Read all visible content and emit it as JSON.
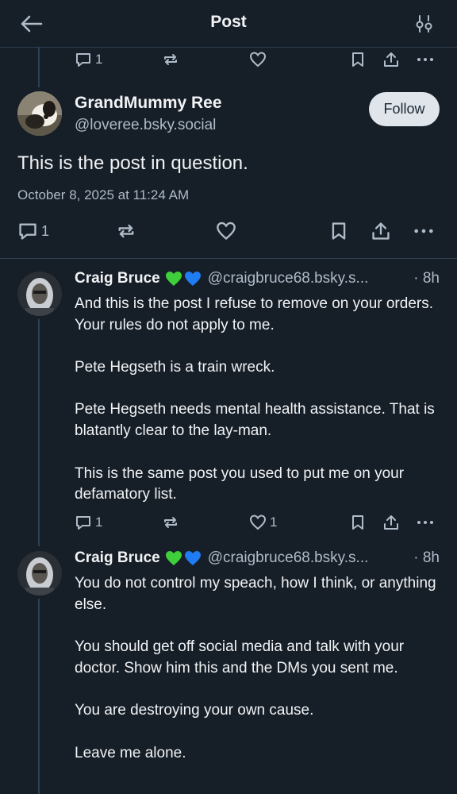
{
  "header": {
    "title": "Post"
  },
  "parent_actions": {
    "reply_count": "1"
  },
  "main_post": {
    "author_name": "GrandMummy Ree",
    "author_handle": "@loveree.bsky.social",
    "follow_label": "Follow",
    "text": "This is the post in question.",
    "timestamp": "October 8, 2025 at 11:24 AM",
    "reply_count": "1"
  },
  "replies": [
    {
      "author_name": "Craig Bruce",
      "author_handle": "@craigbruce68.bsky.s...",
      "time": "· 8h",
      "paragraphs": [
        "And this is the post I refuse to remove on your orders. Your rules do not apply to me.",
        "Pete Hegseth is a train wreck.",
        "Pete Hegseth needs mental health assistance. That is blatantly clear to the lay-man.",
        "This is the same post you used to put me on your defamatory list."
      ],
      "reply_count": "1",
      "like_count": "1"
    },
    {
      "author_name": "Craig Bruce",
      "author_handle": "@craigbruce68.bsky.s...",
      "time": "· 8h",
      "paragraphs": [
        "You do not control my speach, how I think, or anything else.",
        "You should get off social media and talk with your doctor. Show him this and the DMs you sent me.",
        "You are destroying your own cause.",
        "Leave me alone."
      ]
    }
  ],
  "colors": {
    "background": "#161e27",
    "text_primary": "#f1f3f5",
    "text_secondary": "#aebbc9",
    "divider": "#2e4052",
    "heart_green": "#3fcf3a",
    "heart_blue": "#1f7cf2",
    "follow_bg": "#dfe5eb"
  },
  "icons": {
    "back": "arrow-left-icon",
    "settings": "sliders-icon",
    "reply": "speech-bubble-icon",
    "repost": "repost-arrows-icon",
    "like": "heart-icon",
    "bookmark": "bookmark-icon",
    "share": "share-upload-icon",
    "more": "ellipsis-icon"
  }
}
